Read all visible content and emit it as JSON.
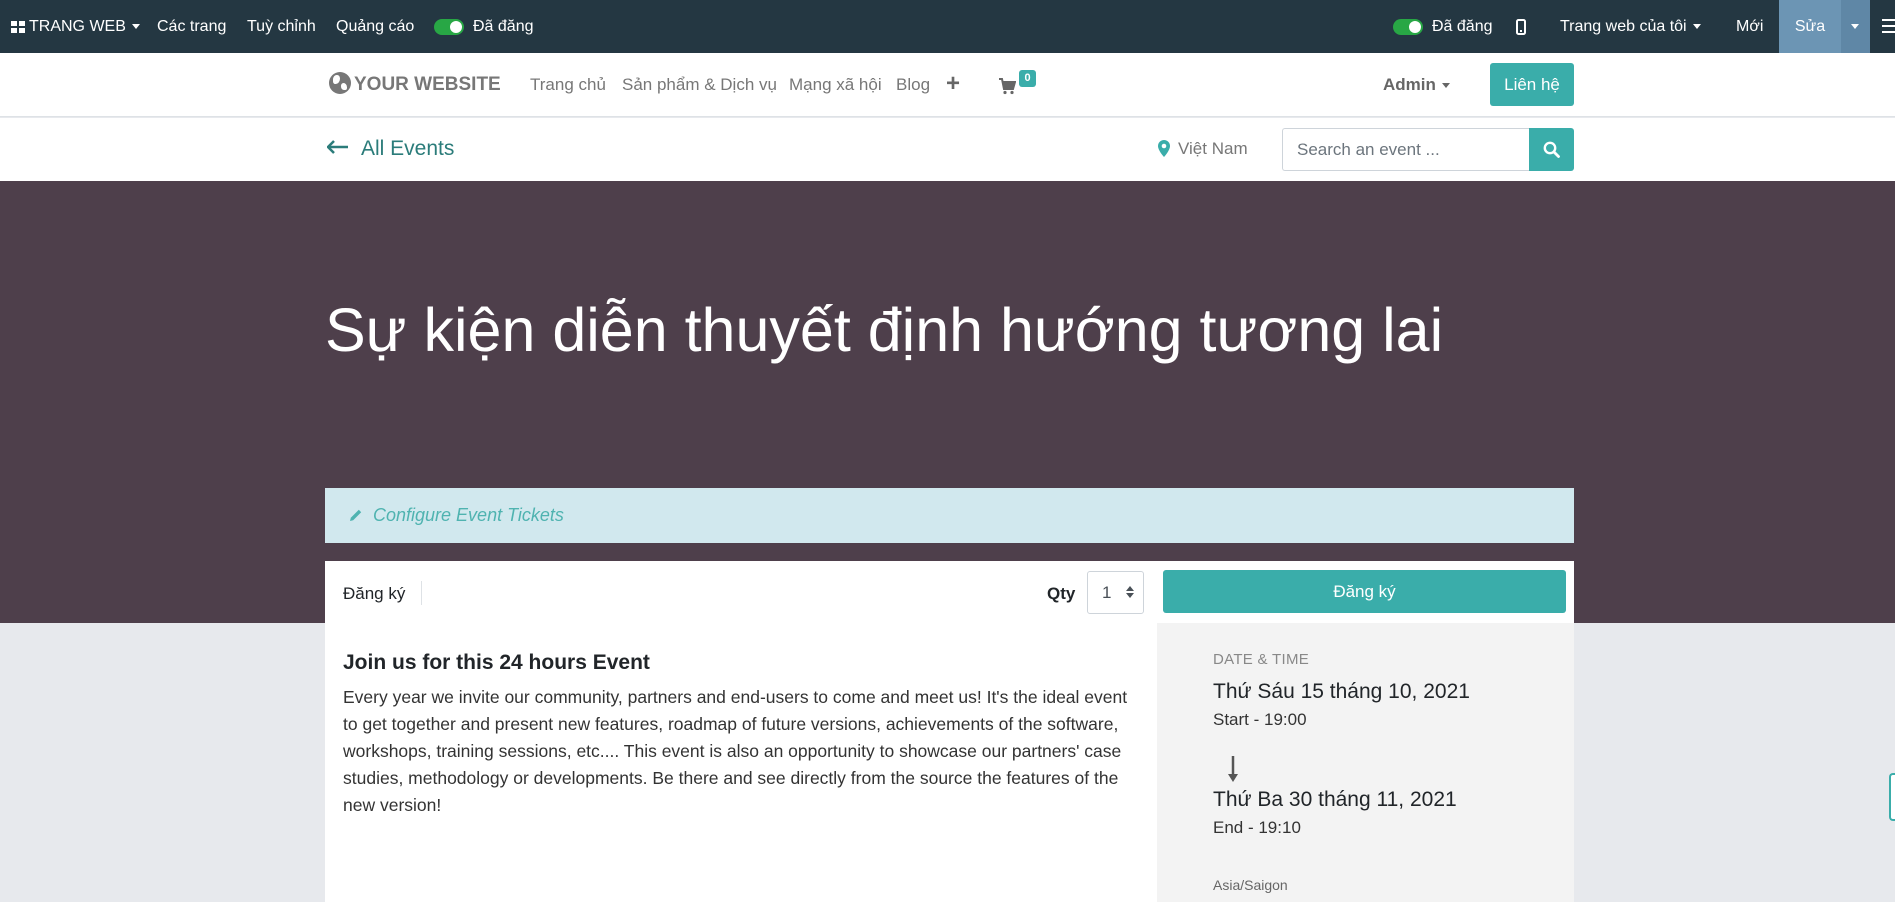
{
  "adminbar": {
    "apps_label": "TRANG WEB",
    "pages_label": "Các trang",
    "customize_label": "Tuỳ chỉnh",
    "promote_label": "Quảng cáo",
    "published_left": "Đã đăng",
    "published_right": "Đã đăng",
    "my_website": "Trang web của tôi",
    "new_label": "Mới",
    "edit_label": "Sửa"
  },
  "navbar": {
    "logo": "YOUR WEBSITE",
    "links": [
      "Trang chủ",
      "Sản phẩm & Dịch vụ",
      "Mạng xã hội",
      "Blog"
    ],
    "cart_count": "0",
    "user": "Admin",
    "contact": "Liên hệ"
  },
  "subbar": {
    "back_label": "All Events",
    "country": "Việt Nam",
    "search_placeholder": "Search an event ..."
  },
  "event": {
    "title": "Sự kiện diễn thuyết định hướng tương lai",
    "configure_tickets": "Configure Event Tickets",
    "register_tab": "Đăng ký",
    "qty_label": "Qty",
    "qty_value": "1",
    "register_button": "Đăng ký",
    "description_title": "Join us for this 24 hours Event",
    "description_body": "Every year we invite our community, partners and end-users to come and meet us! It's the ideal event to get together and present new features, roadmap of future versions, achievements of the software, workshops, training sessions, etc.... This event is also an opportunity to showcase our partners' case studies, methodology or developments. Be there and see directly from the source the features of the new version!",
    "datetime_heading": "DATE & TIME",
    "start_date": "Thứ Sáu 15 tháng 10, 2021",
    "start_time": "Start - 19:00",
    "end_date": "Thứ Ba 30 tháng 11, 2021",
    "end_time": "End - 19:10",
    "timezone": "Asia/Saigon"
  },
  "colors": {
    "adminbar_bg": "#243742",
    "accent": "#3aadaa",
    "hero_bg": "#4e3f4b",
    "configure_bg": "#d1e8ee",
    "edit_bg": "#6c95b4"
  },
  "icons": [
    "apps-icon",
    "mobile-icon",
    "globe-icon",
    "plus-icon",
    "cart-icon",
    "back-arrow-icon",
    "map-marker-icon",
    "search-icon",
    "pencil-icon",
    "arrow-down-icon",
    "hamburger-icon"
  ]
}
